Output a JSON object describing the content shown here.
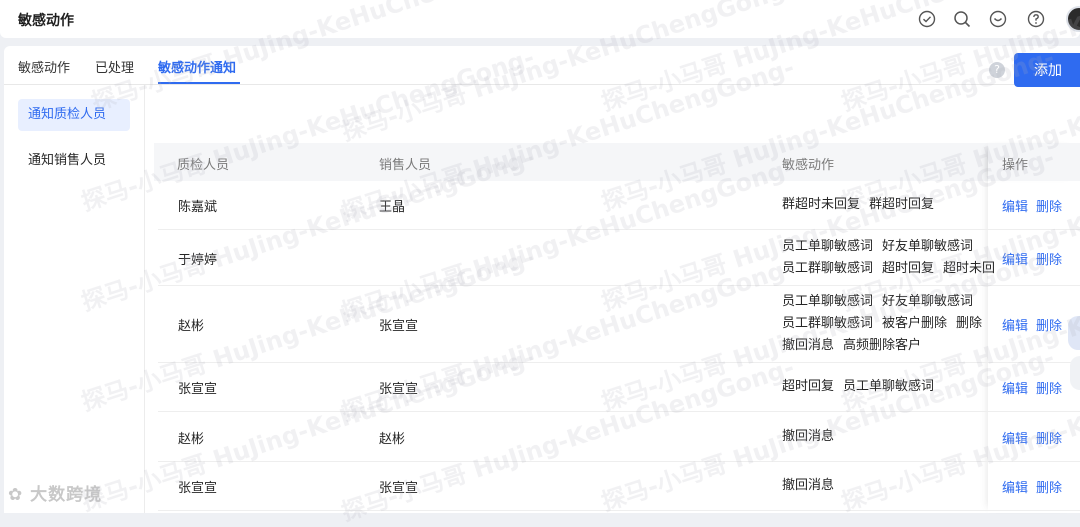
{
  "header": {
    "title": "敏感动作",
    "icons": [
      "check-circle-icon",
      "search-icon",
      "message-icon",
      "help-icon"
    ]
  },
  "tabs": [
    {
      "label": "敏感动作"
    },
    {
      "label": "已处理"
    },
    {
      "label": "敏感动作通知",
      "active": true
    }
  ],
  "sidebar": {
    "items": [
      {
        "label": "通知质检人员",
        "active": true
      },
      {
        "label": "通知销售人员"
      }
    ]
  },
  "toolbar": {
    "help": "?",
    "add_label": "添加"
  },
  "table": {
    "columns": [
      "质检人员",
      "销售人员",
      "敏感动作",
      "操作"
    ],
    "edit_label": "编辑",
    "delete_label": "删除",
    "rows": [
      {
        "inspector": "陈嘉斌",
        "sales": "王晶",
        "actions": [
          [
            "群超时未回复",
            "群超时回复"
          ]
        ]
      },
      {
        "inspector": "于婷婷",
        "sales": "",
        "actions": [
          [
            "员工单聊敏感词",
            "好友单聊敏感词"
          ],
          [
            "员工群聊敏感词",
            "超时回复",
            "超时未回"
          ]
        ]
      },
      {
        "inspector": "赵彬",
        "sales": "张宣宣",
        "actions": [
          [
            "员工单聊敏感词",
            "好友单聊敏感词"
          ],
          [
            "员工群聊敏感词",
            "被客户删除",
            "删除"
          ],
          [
            "撤回消息",
            "高频删除客户"
          ]
        ]
      },
      {
        "inspector": "张宣宣",
        "sales": "张宣宣",
        "actions": [
          [
            "超时回复",
            "员工单聊敏感词"
          ]
        ]
      },
      {
        "inspector": "赵彬",
        "sales": "赵彬",
        "actions": [
          [
            "撤回消息"
          ]
        ]
      },
      {
        "inspector": "张宣宣",
        "sales": "张宣宣",
        "actions": [
          [
            "撤回消息"
          ]
        ]
      }
    ]
  },
  "watermark": {
    "text": "探马-小马哥 HuJing-KeHuChengGong-",
    "brand": "大数跨境"
  }
}
